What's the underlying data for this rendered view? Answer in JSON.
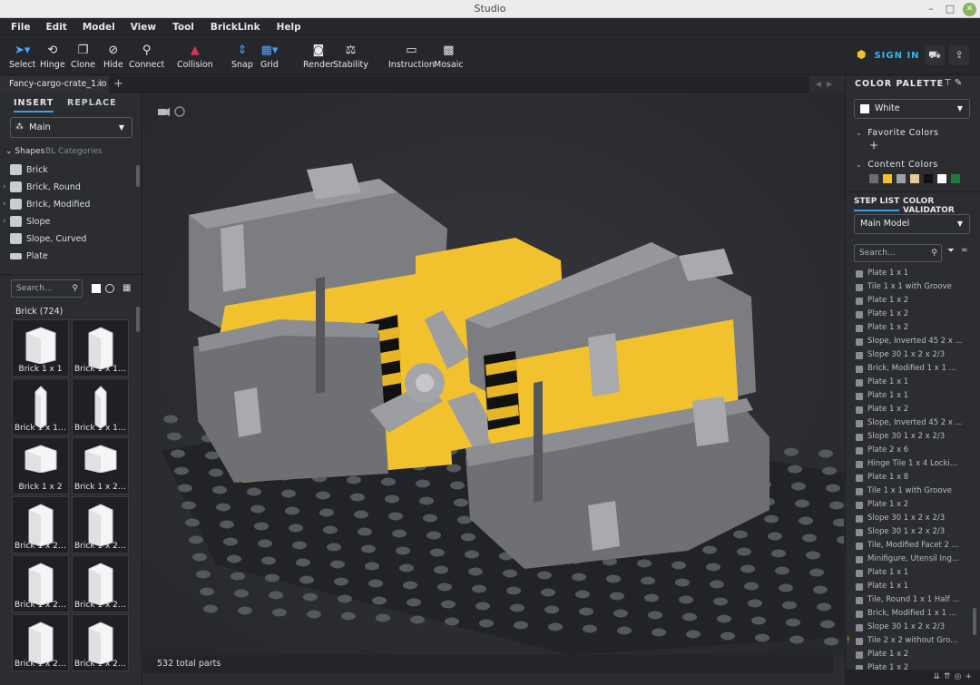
{
  "window": {
    "title": "Studio"
  },
  "menu": [
    "File",
    "Edit",
    "Model",
    "View",
    "Tool",
    "BrickLink",
    "Help"
  ],
  "toolbar": {
    "tools": [
      "Select",
      "Hinge",
      "Clone",
      "Hide",
      "Connect",
      "Collision",
      "Snap",
      "Grid",
      "Render",
      "Stability",
      "Instruction",
      "Mosaic"
    ],
    "sign_in": "SIGN IN"
  },
  "tabs": {
    "file": "Fancy-cargo-crate_1.io"
  },
  "left_panel": {
    "insert": "INSERT",
    "replace": "REPLACE",
    "palette_select": "Main",
    "shapes_tab": "Shapes",
    "bl_categories_tab": "BL Categories",
    "shapes": [
      "Brick",
      "Brick, Round",
      "Brick, Modified",
      "Slope",
      "Slope, Curved",
      "Plate"
    ],
    "search_placeholder": "Search...",
    "category_header": "Brick (724)",
    "bricks": [
      "Brick 1 x 1",
      "Brick 1 x 1 x ...",
      "Brick 1 x 1 x ...",
      "Brick 1 x 1 x ...",
      "Brick 1 x 2",
      "Brick 1 x 2 ...",
      "Brick 1 x 2 x ...",
      "Brick 1 x 2 x ...",
      "Brick 1 x 2 x ...",
      "Brick 1 x 2 x ...",
      "Brick 1 x 2 x ...",
      "Brick 1 x 2 x ..."
    ]
  },
  "viewport": {
    "status": "532 total parts"
  },
  "right_panel": {
    "color_palette": "COLOR PALETTE",
    "selected_color": "White",
    "favorite_colors": "Favorite Colors",
    "content_colors": "Content Colors",
    "content_swatches": [
      "#6b6d70",
      "#f2c12e",
      "#9ea1a5",
      "#e4cc9a",
      "#111111",
      "#ffffff",
      "#1e7a3b"
    ],
    "step_list_tab": "STEP LIST",
    "color_validator_tab": "COLOR VALIDATOR",
    "model_select": "Main Model",
    "search_placeholder": "Search...",
    "steps": [
      "Plate 1 x 1",
      "Tile 1 x 1 with Groove",
      "Plate 1 x 2",
      "Plate 1 x 2",
      "Plate 1 x 2",
      "Slope, Inverted 45 2 x ...",
      "Slope 30 1 x 2 x 2/3",
      "Brick, Modified 1 x 1 ...",
      "Plate 1 x 1",
      "Plate 1 x 1",
      "Plate 1 x 2",
      "Slope, Inverted 45 2 x ...",
      "Slope 30 1 x 2 x 2/3",
      "Plate 2 x 6",
      "Hinge Tile 1 x 4 Locki...",
      "Plate 1 x 8",
      "Tile 1 x 1 with Groove",
      "Plate 1 x 2",
      "Slope 30 1 x 2 x 2/3",
      "Slope 30 1 x 2 x 2/3",
      "Tile, Modified Facet 2 ...",
      "Minifigure, Utensil Ing...",
      "Plate 1 x 1",
      "Plate 1 x 1",
      "Tile, Round 1 x 1 Half ...",
      "Brick, Modified 1 x 1 ...",
      "Slope 30 1 x 2 x 2/3",
      "Tile 2 x 2 without Gro...",
      "Plate 1 x 2",
      "Plate 1 x 2"
    ]
  },
  "colors": {
    "accent": "#3aa0e8",
    "brick_yellow": "#f2c12e",
    "brick_gray": "#8d8f91"
  }
}
